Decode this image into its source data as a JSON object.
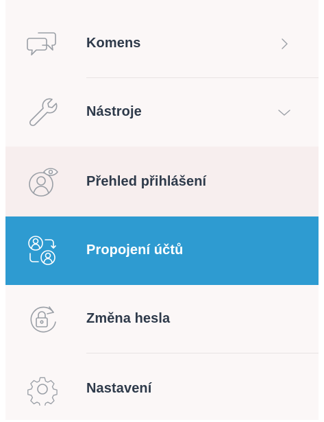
{
  "menu": {
    "items": [
      {
        "label": "Komens",
        "icon": "chat-bubbles-icon",
        "chevron": "chevron-right-icon"
      },
      {
        "label": "Nástroje",
        "icon": "wrench-icon",
        "chevron": "chevron-down-icon"
      },
      {
        "label": "Přehled přihlášení",
        "icon": "user-eye-icon"
      },
      {
        "label": "Propojení účtů",
        "icon": "linked-users-icon"
      },
      {
        "label": "Změna hesla",
        "icon": "lock-refresh-icon"
      },
      {
        "label": "Nastavení",
        "icon": "gear-icon"
      }
    ]
  },
  "colors": {
    "active_bg": "#2e9bd1",
    "text": "#2e3a4a",
    "icon_stroke": "#9a9fa6",
    "menu_bg": "#fbf7f7"
  }
}
